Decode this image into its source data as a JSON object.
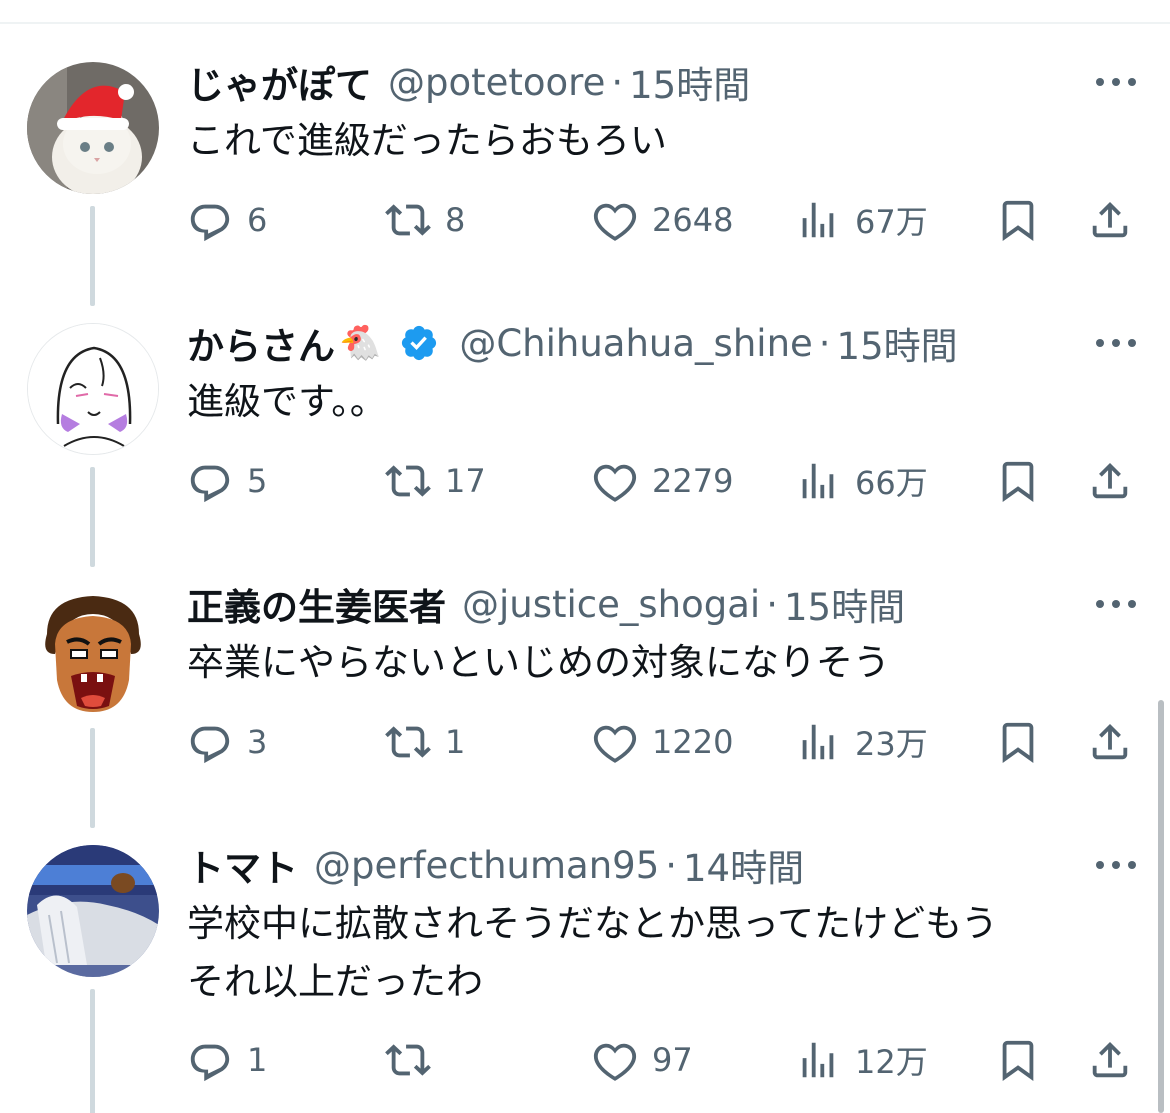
{
  "tweets": [
    {
      "name": "じゃがぽて",
      "emoji": "",
      "verified": false,
      "handle": "@potetoore",
      "dot": "·",
      "time": "15時間",
      "text_lines": [
        "これで進級だったらおもろい"
      ],
      "replies": "6",
      "retweets": "8",
      "likes": "2648",
      "views": "67万"
    },
    {
      "name": "からさん",
      "emoji": "🐔",
      "verified": true,
      "handle": "@Chihuahua_shine",
      "dot": "·",
      "time": "15時間",
      "text_lines": [
        "進級です。。"
      ],
      "replies": "5",
      "retweets": "17",
      "likes": "2279",
      "views": "66万"
    },
    {
      "name": "正義の生姜医者",
      "emoji": "",
      "verified": false,
      "handle": "@justice_shogai",
      "dot": "·",
      "time": "15時間",
      "text_lines": [
        "卒業にやらないといじめの対象になりそう"
      ],
      "replies": "3",
      "retweets": "1",
      "likes": "1220",
      "views": "23万"
    },
    {
      "name": "トマト",
      "emoji": "",
      "verified": false,
      "handle": "@perfecthuman95",
      "dot": "·",
      "time": "14時間",
      "text_lines": [
        "学校中に拡散されそうだなとか思ってたけどもう",
        "それ以上だったわ"
      ],
      "replies": "1",
      "retweets": "",
      "likes": "97",
      "views": "12万"
    }
  ],
  "colors": {
    "text": "#0f1419",
    "secondary": "#536471",
    "thread_line": "#cfd9de",
    "verified": "#1d9bf0"
  },
  "icons": [
    "reply-icon",
    "retweet-icon",
    "like-icon",
    "views-icon",
    "bookmark-icon",
    "share-icon",
    "more-icon",
    "verified-badge-icon"
  ]
}
